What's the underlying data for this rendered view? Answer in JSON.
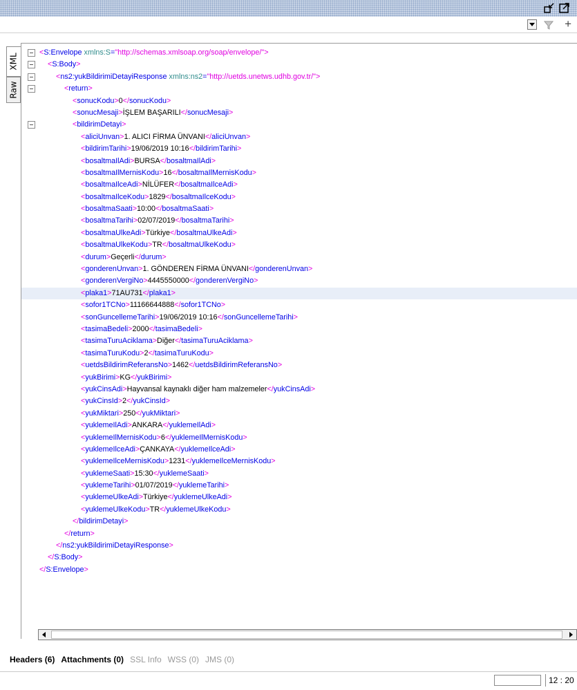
{
  "window": {
    "icons": [
      "shrink-icon",
      "expand-icon"
    ]
  },
  "toolbar": {
    "dropdown_icon": "dropdown-arrow-icon",
    "filter_icon": "filter-icon",
    "add_label": "+"
  },
  "side_tabs": [
    {
      "label": "XML",
      "active": true
    },
    {
      "label": "Raw",
      "active": false
    }
  ],
  "xml": {
    "envelope_open_tag": "S:Envelope",
    "envelope_attr_name": "xmlns:S",
    "envelope_attr_value": "\"http://schemas.xmlsoap.org/soap/envelope/\"",
    "body_tag": "S:Body",
    "response_tag": "ns2:yukBildirimiDetayiResponse",
    "response_attr_name": "xmlns:ns2",
    "response_attr_value": "\"http://uetds.unetws.udhb.gov.tr/\"",
    "return_tag": "return",
    "sonucKodu": "0",
    "sonucMesaji": "İŞLEM BAŞARILI",
    "detay_tag": "bildirimDetayi",
    "fields": [
      {
        "name": "aliciUnvan",
        "value": "1. ALICI FİRMA ÜNVANI"
      },
      {
        "name": "bildirimTarihi",
        "value": "19/06/2019 10:16"
      },
      {
        "name": "bosaltmaIlAdi",
        "value": "BURSA"
      },
      {
        "name": "bosaltmaIlMernisKodu",
        "value": "16"
      },
      {
        "name": "bosaltmaIlceAdi",
        "value": "NİLÜFER"
      },
      {
        "name": "bosaltmaIlceKodu",
        "value": "1829"
      },
      {
        "name": "bosaltmaSaati",
        "value": "10:00"
      },
      {
        "name": "bosaltmaTarihi",
        "value": "02/07/2019"
      },
      {
        "name": "bosaltmaUlkeAdi",
        "value": "Türkiye"
      },
      {
        "name": "bosaltmaUlkeKodu",
        "value": "TR"
      },
      {
        "name": "durum",
        "value": "Geçerli"
      },
      {
        "name": "gonderenUnvan",
        "value": "1. GÖNDEREN FİRMA ÜNVANI"
      },
      {
        "name": "gonderenVergiNo",
        "value": "4445550000"
      },
      {
        "name": "plaka1",
        "value": "71AU731"
      },
      {
        "name": "sofor1TCNo",
        "value": "11166644888"
      },
      {
        "name": "sonGuncellemeTarihi",
        "value": "19/06/2019 10:16"
      },
      {
        "name": "tasimaBedeli",
        "value": "2000"
      },
      {
        "name": "tasimaTuruAciklama",
        "value": "Diğer"
      },
      {
        "name": "tasimaTuruKodu",
        "value": "2"
      },
      {
        "name": "uetdsBildirimReferansNo",
        "value": "1462"
      },
      {
        "name": "yukBirimi",
        "value": "KG"
      },
      {
        "name": "yukCinsAdi",
        "value": "Hayvansal kaynaklı diğer ham malzemeler"
      },
      {
        "name": "yukCinsId",
        "value": "2"
      },
      {
        "name": "yukMiktari",
        "value": "250"
      },
      {
        "name": "yuklemeIlAdi",
        "value": "ANKARA"
      },
      {
        "name": "yuklemeIlMernisKodu",
        "value": "6"
      },
      {
        "name": "yuklemeIlceAdi",
        "value": "ÇANKAYA"
      },
      {
        "name": "yuklemeIlceMernisKodu",
        "value": "1231"
      },
      {
        "name": "yuklemeSaati",
        "value": "15:30"
      },
      {
        "name": "yuklemeTarihi",
        "value": "01/07/2019"
      },
      {
        "name": "yuklemeUlkeAdi",
        "value": "Türkiye"
      },
      {
        "name": "yuklemeUlkeKodu",
        "value": "TR"
      }
    ]
  },
  "bottom_tabs": [
    {
      "label": "Headers (6)",
      "active": true
    },
    {
      "label": "Attachments (0)",
      "active": true
    },
    {
      "label": "SSL Info",
      "active": false
    },
    {
      "label": "WSS (0)",
      "active": false
    },
    {
      "label": "JMS (0)",
      "active": false
    }
  ],
  "status": {
    "cursor_position": "12 : 20"
  }
}
